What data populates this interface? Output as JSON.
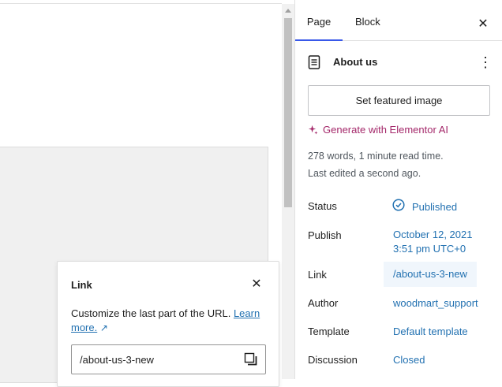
{
  "popover": {
    "title": "Link",
    "description": "Customize the last part of the URL.",
    "learn_more": "Learn more.",
    "external_glyph": "↗",
    "slug_value": "/about-us-3-new"
  },
  "sidebar": {
    "tabs": [
      {
        "label": "Page"
      },
      {
        "label": "Block"
      }
    ],
    "document_title": "About us",
    "featured_button": "Set featured image",
    "ai_link": "Generate with Elementor AI",
    "word_count": "278 words, 1 minute read time.",
    "last_edited": "Last edited a second ago.",
    "rows": {
      "status": {
        "label": "Status",
        "value": "Published"
      },
      "publish": {
        "label": "Publish",
        "value_line1": "October 12, 2021",
        "value_line2": "3:51 pm UTC+0"
      },
      "link": {
        "label": "Link",
        "value": "/about-us-3-new"
      },
      "author": {
        "label": "Author",
        "value": "woodmart_support"
      },
      "template": {
        "label": "Template",
        "value": "Default template"
      },
      "discussion": {
        "label": "Discussion",
        "value": "Closed"
      }
    }
  },
  "colors": {
    "accent": "#3858e9",
    "link": "#2271b1",
    "ai": "#a4286a"
  }
}
